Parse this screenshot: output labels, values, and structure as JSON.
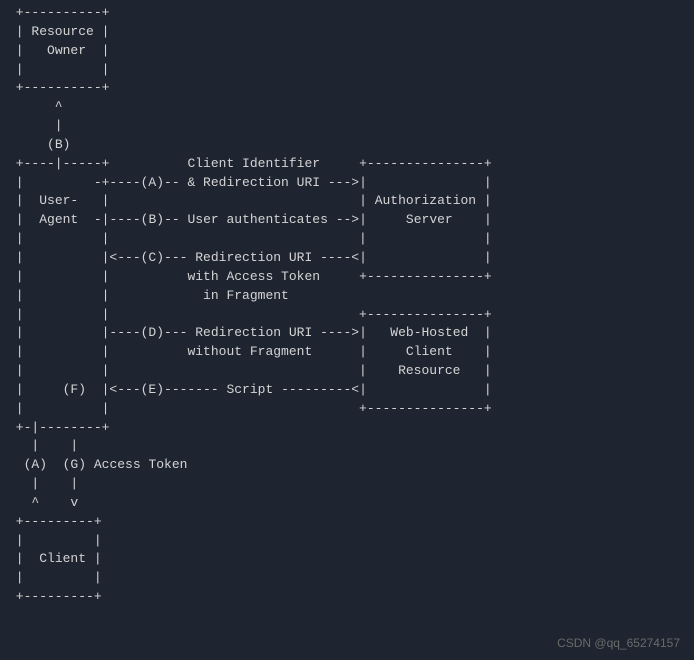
{
  "boxes": {
    "resource_owner_l1": "Resource",
    "resource_owner_l2": "Owner",
    "user_agent_l1": "User-",
    "user_agent_l2": "Agent",
    "auth_server_l1": "Authorization",
    "auth_server_l2": "Server",
    "web_hosted_l1": "Web-Hosted",
    "web_hosted_l2": "Client",
    "web_hosted_l3": "Resource",
    "client": "Client"
  },
  "steps": {
    "a": "(A)",
    "b": "(B)",
    "c": "(C)",
    "d": "(D)",
    "e": "(E)",
    "f": "(F)",
    "g": "(G)"
  },
  "labels": {
    "client_identifier": "Client Identifier",
    "redirection_uri": "& Redirection URI",
    "user_authenticates": "User authenticates",
    "redirection_uri_2": "Redirection URI",
    "with_access_token": "with Access Token",
    "in_fragment": "in Fragment",
    "without_fragment": "without Fragment",
    "script": "Script",
    "access_token": "Access Token"
  },
  "watermark": "CSDN @qq_65274157"
}
